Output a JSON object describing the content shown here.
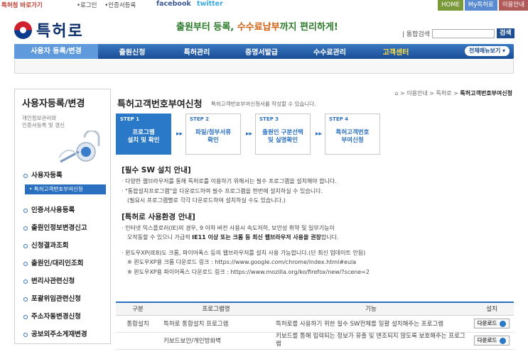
{
  "topbar": {
    "shortcut": "특허청 바로가기",
    "login": "•로그인",
    "join": "•인증서등록",
    "facebook": "facebook",
    "twitter": "twitter",
    "buttons": [
      {
        "label": "HOME",
        "color": "#7a9a3a"
      },
      {
        "label": "My특허로",
        "color": "#5a8ad0"
      },
      {
        "label": "이용안내",
        "color": "#b05a5a"
      }
    ]
  },
  "logo": {
    "text": "특허로"
  },
  "slogan": {
    "part1": "출원부터 등록, ",
    "highlight": "수수료납부",
    "part2": "까지 편리하게!"
  },
  "search": {
    "label": "| 통합검색",
    "button": "검색",
    "value": ""
  },
  "gnb": {
    "items": [
      "사용자 등록/변경",
      "출원신청",
      "특허관리",
      "증명서발급",
      "수수료관리",
      "고객센터"
    ],
    "allmenu": "전체메뉴보기"
  },
  "lnb": {
    "title": "사용자등록/변경",
    "desc_line1": "개인정보관리와",
    "desc_line2": "인증서등록 및 갱신",
    "items": {
      "user_reg": "사용자등록",
      "sub_customer_no": "• 특허고객번호부여신청",
      "cert_reg": "인증서사용등록",
      "applicant_change": "출원인정보변경신고",
      "result": "신청결과조회",
      "applicant_lookup": "출원인/대리인조회",
      "attorney": "변리사관련신청",
      "comprehensive": "포괄위임관련신청",
      "address_auto": "주소자동변경신청",
      "public_consent": "공보외주소게재변경"
    }
  },
  "breadcrumb": {
    "home": "⌂",
    "p1": "이용안내",
    "p2": "특허로",
    "current": "특허고객번호부여신청"
  },
  "page": {
    "title": "특허고객번호부여신청",
    "desc": "특허고객번호부여신청서를 작성할 수 있습니다."
  },
  "steps": [
    {
      "no": "STEP 1",
      "line1": "프로그램",
      "line2": "설치 및 확인",
      "active": true
    },
    {
      "no": "STEP 2",
      "line1": "파일/첨부서류",
      "line2": "확인",
      "active": false
    },
    {
      "no": "STEP 3",
      "line1": "출원인 구분선택",
      "line2": "및 실명확인",
      "active": false
    },
    {
      "no": "STEP 4",
      "line1": "특허고객번호",
      "line2": "부여신청",
      "active": false
    }
  ],
  "notice1": {
    "title": "[필수 SW 설치 안내]",
    "l1": "· 다양한 웹브라우저를 통해 특허로를 이용하기 위해서는 필수 프로그램을 설치해야 합니다.",
    "l2": "· \"통합설치프로그램\"을 다운로드하여 필수 프로그램을 한번에 설치하실 수 있습니다.",
    "l3": "(필요시 프로그램별로 각각 다운로드하여 설치하실 수도 있습니다.)"
  },
  "notice2": {
    "title": "[특허로 사용환경 안내]",
    "l1": "· 인터넷 익스플로러(IE)의 경우, 9 이하 버전 사용시 속도저하, 보안성 취약 및 일부기능이",
    "l2a": "오작동할 수 있으니 가급적 ",
    "l2b": "IE11 이상 또는 크롬 등 최신 웹브라우저 사용을 권장",
    "l2c": "합니다.",
    "l3": "· 윈도우XP(IE8)도 크롬, 파이어폭스 등의 웹브라우저를 설치 사용 가능합니다.(단 최신 업데이트 안됨)",
    "l4": "※ 윈도우XP용 크롬 다운로드 링크 : https://www.google.com/chrome/index.html#eula",
    "l5": "※ 윈도우XP용 파이어폭스 다운로드 링크 : https://www.mozilla.org/ko/firefox/new/?scene=2"
  },
  "table": {
    "headers": [
      "구분",
      "프로그램명",
      "기능",
      "설치"
    ],
    "rows": [
      {
        "category": "통합설치",
        "name": "특허로 통합설치 프로그램",
        "func": "특허로를 사용하기 위한 필수 SW전체를 일괄 설치해주는 프로그램",
        "install": "다운로드"
      },
      {
        "category": "",
        "name": "키보드보안/개인방화벽",
        "func": "키보드를 통해 입력되는 정보가 유출 및 변조되지 않도록 보호해주는 프로그램",
        "install": "다운로드"
      }
    ]
  }
}
